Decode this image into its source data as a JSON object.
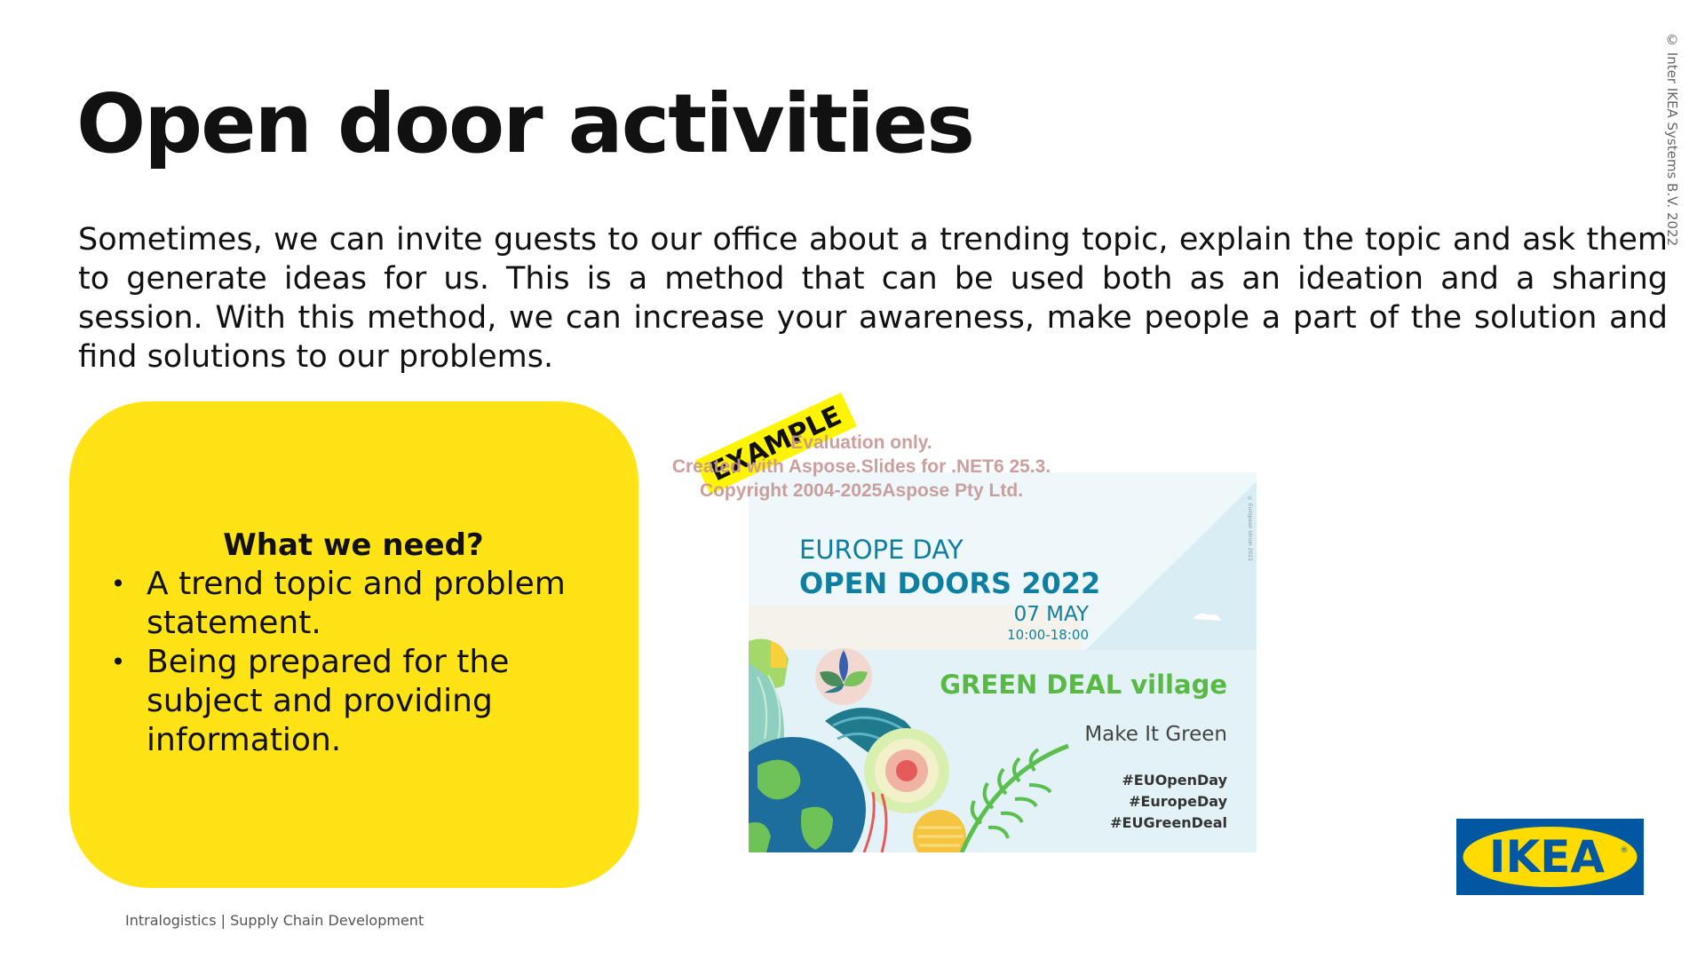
{
  "slide": {
    "title": "Open door activities",
    "body": "Sometimes, we can invite guests to our office about a trending topic, explain the topic and ask them to generate ideas for us. This is a method that can be used both as an ideation and a sharing session. With this method, we can increase your awareness, make people a part of the solution and find solutions to our problems.",
    "copyright": "© Inter IKEA Systems B.V. 2022",
    "footer": "Intralogistics | Supply Chain Development"
  },
  "need_box": {
    "heading": "What we need?",
    "bullet": "•",
    "items": [
      "A trend topic and problem statement.",
      "Being prepared for the subject and providing information."
    ],
    "color": "#ffe314"
  },
  "eu_image": {
    "line1": "EUROPE DAY",
    "line2": "OPEN DOORS 2022",
    "date": "07 MAY",
    "hours": "10:00-18:00",
    "green_deal": "GREEN DEAL village",
    "make_it_green": "Make It Green",
    "hashtags": [
      "#EUOpenDay",
      "#EuropeDay",
      "#EUGreenDeal"
    ],
    "tiny_credit": "© European Union 2022"
  },
  "example_label": "EXAMPLE",
  "watermark": [
    "Evaluation only.",
    "Created with Aspose.Slides for .NET6 25.3.",
    "Copyright 2004-2025Aspose Pty Ltd."
  ],
  "logo": {
    "text": "IKEA",
    "registered": "®",
    "blue": "#0058a3",
    "yellow": "#ffdb00"
  }
}
